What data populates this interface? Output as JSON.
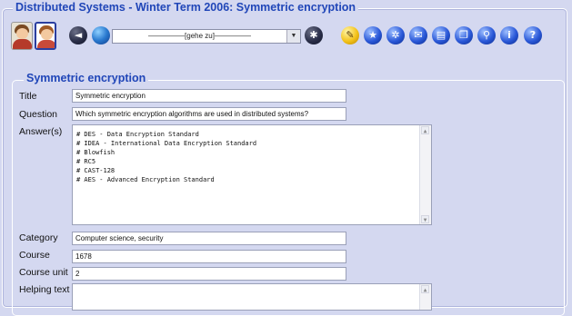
{
  "window": {
    "title": "Distributed Systems - Winter Term 2006: Symmetric encryption"
  },
  "toolbar": {
    "navigation_select": {
      "selected": "[gehe zu]"
    },
    "round_icons": [
      {
        "name": "back-icon",
        "glyph": "◄",
        "style": "dark"
      },
      {
        "name": "globe-icon",
        "glyph": "",
        "style": "globe"
      },
      {
        "name": "tools-icon",
        "glyph": "✱",
        "style": "dark"
      },
      {
        "name": "note-icon",
        "glyph": "✎",
        "style": "yellow"
      },
      {
        "name": "star-icon",
        "glyph": "★",
        "style": "blue"
      },
      {
        "name": "network-icon",
        "glyph": "✲",
        "style": "blue"
      },
      {
        "name": "mail-icon",
        "glyph": "✉",
        "style": "blue"
      },
      {
        "name": "document-icon",
        "glyph": "▤",
        "style": "blue"
      },
      {
        "name": "pages-icon",
        "glyph": "❐",
        "style": "blue"
      },
      {
        "name": "search-icon",
        "glyph": "⚲",
        "style": "blue"
      },
      {
        "name": "info-icon",
        "glyph": "i",
        "style": "blue"
      },
      {
        "name": "help-icon",
        "glyph": "?",
        "style": "blue"
      }
    ]
  },
  "form": {
    "legend": "Symmetric encryption",
    "title": {
      "label": "Title",
      "value": "Symmetric encryption"
    },
    "question": {
      "label": "Question",
      "value": "Which symmetric encryption algorithms are used in distributed systems?"
    },
    "answers": {
      "label": "Answer(s)",
      "lines": [
        "# DES - Data Encryption Standard",
        "# IDEA - International Data Encryption Standard",
        "# Blowfish",
        "# RC5",
        "# CAST-128",
        "# AES - Advanced Encryption Standard"
      ]
    },
    "category": {
      "label": "Category",
      "value": "Computer science, security"
    },
    "course": {
      "label": "Course",
      "value": "1678"
    },
    "course_unit": {
      "label": "Course unit",
      "value": "2"
    },
    "helping_text": {
      "label": "Helping text",
      "value": ""
    }
  },
  "scroll_glyphs": {
    "up": "▲",
    "down": "▼"
  }
}
